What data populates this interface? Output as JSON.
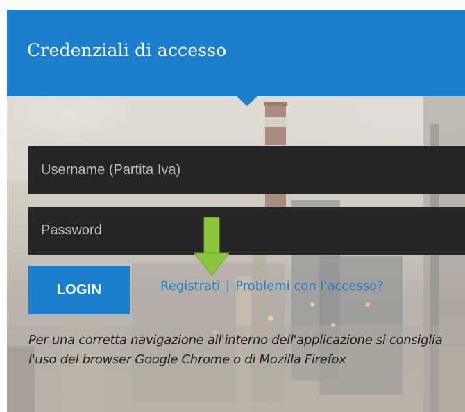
{
  "header": {
    "title": "Credenziali di accesso"
  },
  "form": {
    "username_placeholder": "Username (Partita Iva)",
    "password_placeholder": "Password",
    "login_label": "LOGIN"
  },
  "links": {
    "register": "Registrati",
    "separator": "|",
    "problems": "Problemi con l'accesso?"
  },
  "note": "Per una corretta navigazione all'interno dell'applicazione si consiglia l'uso del browser Google Chrome o di Mozilla Firefox",
  "colors": {
    "primary": "#1b7fce",
    "field_bg": "#262626",
    "highlight_arrow": "#8cc63f"
  },
  "icons": {
    "pointer": "down-arrow-icon",
    "notch": "caret-down-icon"
  }
}
